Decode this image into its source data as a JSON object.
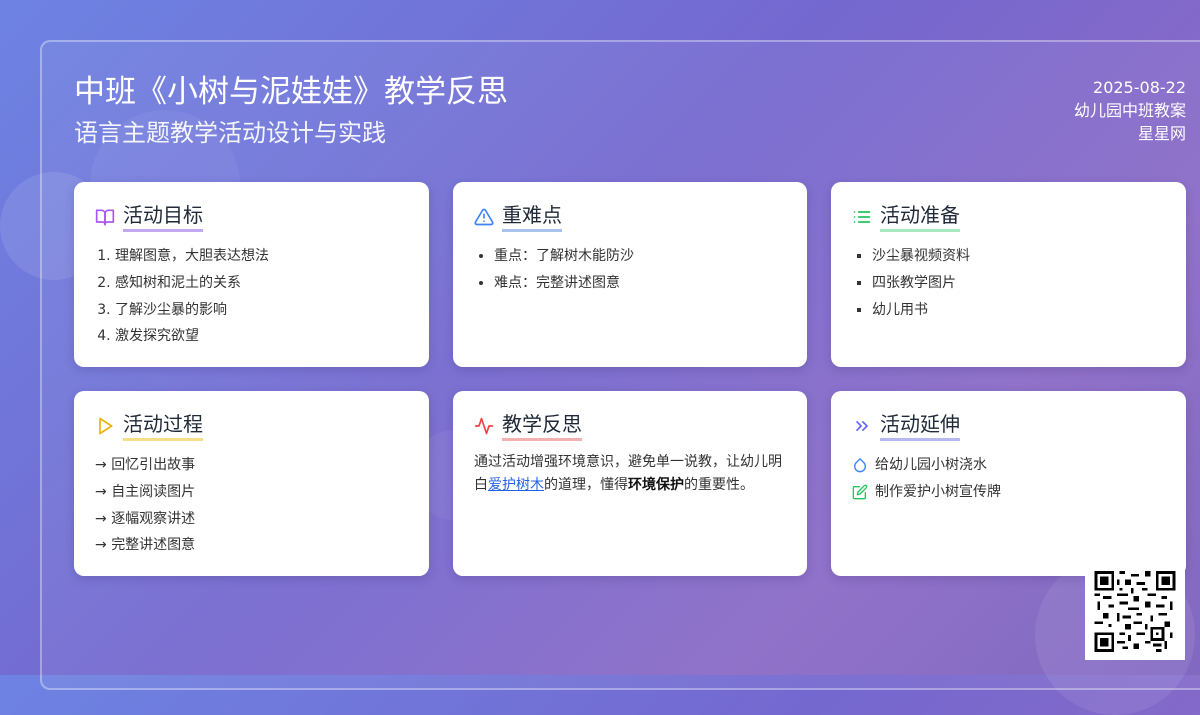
{
  "header": {
    "title": "中班《小树与泥娃娃》教学反思",
    "subtitle": "语言主题教学活动设计与实践",
    "date": "2025-08-22",
    "category": "幼儿园中班教案",
    "source": "星星网"
  },
  "cards": {
    "goals": {
      "title": "活动目标",
      "icon": "book-open-icon",
      "accent": "#c4a8ee",
      "items": [
        "理解图意，大胆表达想法",
        "感知树和泥土的关系",
        "了解沙尘暴的影响",
        "激发探究欲望"
      ]
    },
    "keypoints": {
      "title": "重难点",
      "icon": "alert-triangle-icon",
      "accent": "#a8c4ee",
      "items": [
        "重点：了解树木能防沙",
        "难点：完整讲述图意"
      ]
    },
    "preparation": {
      "title": "活动准备",
      "icon": "list-icon",
      "accent": "#a8e6c0",
      "items": [
        "沙尘暴视频资料",
        "四张教学图片",
        "幼儿用书"
      ]
    },
    "process": {
      "title": "活动过程",
      "icon": "play-icon",
      "accent": "#f5df8a",
      "items": [
        "回忆引出故事",
        "自主阅读图片",
        "逐幅观察讲述",
        "完整讲述图意"
      ]
    },
    "reflection": {
      "title": "教学反思",
      "icon": "activity-icon",
      "accent": "#f3b0b0",
      "text_1": "通过活动增强环境意识，避免单一说教，让幼儿明白",
      "link_text": "爱护树木",
      "text_2": "的道理，懂得",
      "bold_text": "环境保护",
      "text_3": "的重要性。"
    },
    "extension": {
      "title": "活动延伸",
      "icon": "chevrons-right-icon",
      "accent": "#b8b8f0",
      "items": [
        {
          "icon": "droplet-icon",
          "label": "给幼儿园小树浇水"
        },
        {
          "icon": "edit-icon",
          "label": "制作爱护小树宣传牌"
        }
      ]
    }
  },
  "colors": {
    "bg_start": "#6d83e3",
    "bg_end": "#7a5fbe",
    "goals_icon": "#a855f7",
    "keypoints_icon": "#3b82f6",
    "preparation_icon": "#22c55e",
    "process_icon": "#eab308",
    "reflection_icon": "#ef4444",
    "extension_icon": "#6366f1"
  }
}
